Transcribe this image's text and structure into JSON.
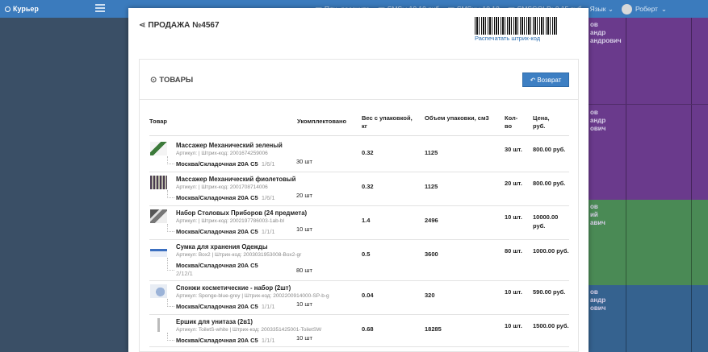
{
  "app": {
    "title": "Курьер"
  },
  "topnav": {
    "items": [
      "Плн. рассчита",
      "SMSы 10.10 руб",
      "SMSны 10.10 ",
      "SMSGOLD: 0.15 руб"
    ],
    "lang": "Язык",
    "user": "Роберт"
  },
  "background": {
    "bands": [
      {
        "lines": [
          "ов",
          "андр",
          "андрович"
        ],
        "color": "#6a3a8c"
      },
      {
        "lines": [
          "ов",
          "андр",
          "ович"
        ],
        "color": "#6a3a8c"
      },
      {
        "lines": [
          "ов",
          "ий",
          "авич"
        ],
        "color": "#4a8a55"
      },
      {
        "lines": [
          "ов",
          "андр",
          "ович"
        ],
        "color": "#35628f"
      }
    ]
  },
  "modal": {
    "title": "ПРОДАЖА №4567",
    "print_barcode": "Распечатать штрих-код",
    "panel_title": "ТОВАРЫ",
    "return_button": "Возврат",
    "headers": {
      "product": "Товар",
      "assembled": "Укомплектовано",
      "weight": "Вес с упаковкой, кг",
      "volume": "Объем упаковки, см3",
      "count": "Кол-во",
      "price": "Цена, руб."
    },
    "rows": [
      {
        "name": "Массажер Механический зеленый",
        "art": "Артикул:  | Штрих-код: 2001674259006",
        "warehouse": "Москва/Складочная 20А С5",
        "wh_suffix": "1/6/1",
        "assembled": "30 шт",
        "weight": "0.32",
        "volume": "1125",
        "count": "30 шт.",
        "price": "800.00 руб.",
        "thumb": "green-massager"
      },
      {
        "name": "Массажер Механический фиолетовый",
        "art": "Артикул:  | Штрих-код: 2001708714006",
        "warehouse": "Москва/Складочная 20А С5",
        "wh_suffix": "1/6/1",
        "assembled": "20 шт",
        "weight": "0.32",
        "volume": "1125",
        "count": "20 шт.",
        "price": "800.00 руб.",
        "thumb": "violet-massager"
      },
      {
        "name": "Набор Столовых Приборов (24 предмета)",
        "art": "Артикул:  | Штрих-код: 2002197786003-1ab-bl",
        "warehouse": "Москва/Складочная 20А С5",
        "wh_suffix": "1/1/1",
        "assembled": "10 шт",
        "weight": "1.4",
        "volume": "2496",
        "count": "10 шт.",
        "price": "10000.00 руб.",
        "thumb": "cutlery"
      },
      {
        "name": "Сумка для хранения Одежды",
        "art": "Артикул: Box2 | Штрих-код: 2003031953008-Box2-gr",
        "warehouse": "Москва/Складочная 20А С5",
        "wh_suffix": "2/12/1",
        "assembled": "80 шт",
        "weight": "0.5",
        "volume": "3600",
        "count": "80 шт.",
        "price": "1000.00 руб.",
        "thumb": "bag"
      },
      {
        "name": "Спонжи косметические - набор (2шт)",
        "art": "Артикул: Sponge-blue-grey | Штрих-код: 2002200914000-SP-b-g",
        "warehouse": "Москва/Складочная 20А С5",
        "wh_suffix": "1/1/1",
        "assembled": "10 шт",
        "weight": "0.04",
        "volume": "320",
        "count": "10 шт.",
        "price": "590.00 руб.",
        "thumb": "sponge"
      },
      {
        "name": "Ершик для унитаза (2в1)",
        "art": "Артикул: ToiletS-white | Штрих-код: 2003351425001-ToiletSW",
        "warehouse": "Москва/Складочная 20А С5",
        "wh_suffix": "1/1/1",
        "assembled": "10 шт",
        "weight": "0.68",
        "volume": "18285",
        "count": "10 шт.",
        "price": "1500.00 руб.",
        "thumb": "brush"
      }
    ]
  }
}
